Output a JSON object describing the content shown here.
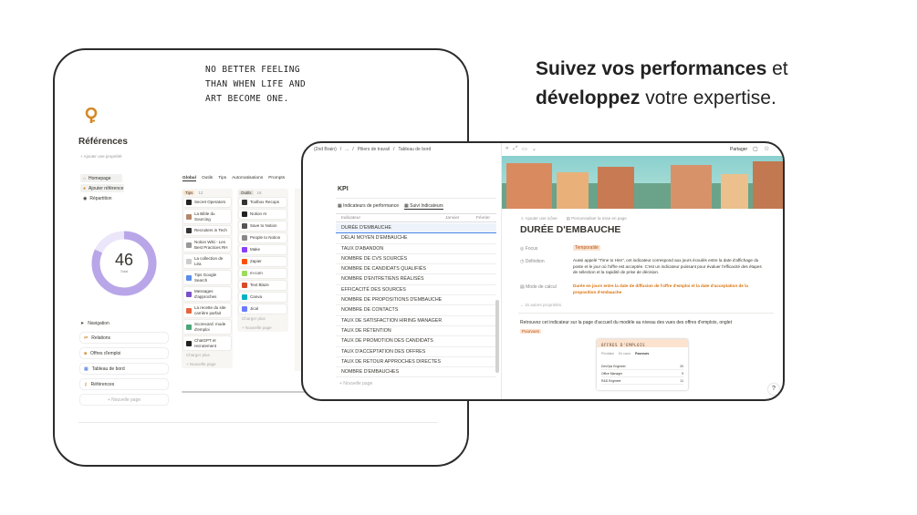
{
  "headline": {
    "l1_bold": "Suivez vos performances",
    "l1_rest": " et",
    "l2_bold": "développez",
    "l2_rest": " votre expertise."
  },
  "left": {
    "quote": "NO BETTER FEELING\nTHAN WHEN LIFE AND\nART BECOME ONE.",
    "page_title": "Références",
    "add_property": "+ Ajouter une propriété",
    "pills": [
      "Homepage",
      "Ajouter référence",
      "Répartition"
    ],
    "donut": {
      "value": "46",
      "label": "Total",
      "fraction": 0.82
    },
    "tabs": [
      "Global",
      "Outils",
      "Tips",
      "Automatisations",
      "Prompts"
    ],
    "groups": [
      {
        "name": "Tips",
        "count": "12"
      },
      {
        "name": "Outils",
        "count": "16"
      }
    ],
    "tips": [
      "Secret Operators",
      "La Bible du Sourcing",
      "Recruiters in Tech",
      "Notion Wiki - Les Best Practices RH",
      "La collection de Léa",
      "Tips Google Search",
      "Messages d'approches",
      "La recette du site carrière parfait",
      "Scorecard: mode d'emploi",
      "ChatGPT et recrutement"
    ],
    "outils": [
      "Toolbox Recops",
      "Notion AI",
      "Save to Notion",
      "People to Notion",
      "Make",
      "Zapier",
      "m-com",
      "Text Blaze",
      "Canva",
      "Jical"
    ],
    "load_more": "Charger plus",
    "new_page": "+ Nouvelle page",
    "nav": [
      "Navigation",
      "Relations",
      "Offres d'emploi",
      "Tableau de bord",
      "Références"
    ],
    "nav_new": "+ Nouvelle page"
  },
  "right": {
    "breadcrumb": [
      "(2nd Brain)",
      "...",
      "Piliers de travail",
      "Tableau de bord"
    ],
    "share": "Partager",
    "kpi_title": "KPI",
    "kpi_tabs": [
      "Indicateurs de performance",
      "Suivi Indicateurs"
    ],
    "kpi_header": [
      "Indicateur",
      "Janvier",
      "Février"
    ],
    "kpis": [
      "DURÉE D'EMBAUCHE",
      "DÉLAI MOYEN D'EMBAUCHE",
      "TAUX D'ABANDON",
      "NOMBRE DE CVS SOURCÉS",
      "NOMBRE DE CANDIDATS QUALIFIÉS",
      "NOMBRE D'ENTRETIENS RÉALISÉS",
      "EFFICACITÉ DES SOURCES",
      "NOMBRE DE PROPOSITIONS D'EMBAUCHE",
      "NOMBRE DE CONTACTS",
      "TAUX DE SATISFACTION HIRING MANAGER",
      "TAUX DE RÉTENTION",
      "TAUX DE PROMOTION DES CANDIDATS",
      "TAUX D'ACCEPTATION DES OFFRES",
      "TAUX DE RETOUR APPROCHES DIRECTES",
      "NOMBRE D'EMBAUCHES"
    ],
    "kpi_new": "+ Nouvelle page",
    "detail": {
      "add_icon": "Ajouter une icône",
      "custom_page": "Personnaliser la mise en page",
      "title": "DURÉE D'EMBAUCHE",
      "focus_label": "Focus",
      "focus_value": "Temporalité",
      "def_label": "Définition",
      "def_text": "Aussi appelé \"Time to Hire\", cet indicateur correspond aux jours écoulés entre la date d'affichage du poste et le jour où l'offre est acceptée. C'est un indicateur puissant pour évaluer l'efficacité des étapes de sélection et la rapidité de prise de décision.",
      "calc_label": "Mode de calcul",
      "calc_text": "Durée en jours entre la date de diffusion de l'offre d'emploi et la date d'acceptation de la proposition d'embauche",
      "more": "15 autres propriétés",
      "body": "Retrouvez cet indicateur sur la page d'accueil du modèle au niveau des vues des offres d'emplois, onglet",
      "tag": "Pourvues",
      "mini_title": "OFFRES D'EMPLOIS",
      "mini_tabs": [
        "Prioritaire",
        "En cours",
        "Pourvues"
      ],
      "mini_rows": [
        {
          "name": "DevOps Engineer",
          "n": "20"
        },
        {
          "name": "Office Manager",
          "n": "9"
        },
        {
          "name": "R&D Engineer",
          "n": "11"
        }
      ]
    }
  },
  "colors": {
    "accent_orange": "#e08a2e",
    "donut": "#b9a6e8",
    "donut_track": "#ece6fa",
    "tag_bg": "#fbe3cf",
    "tag_text": "#b5541c"
  }
}
